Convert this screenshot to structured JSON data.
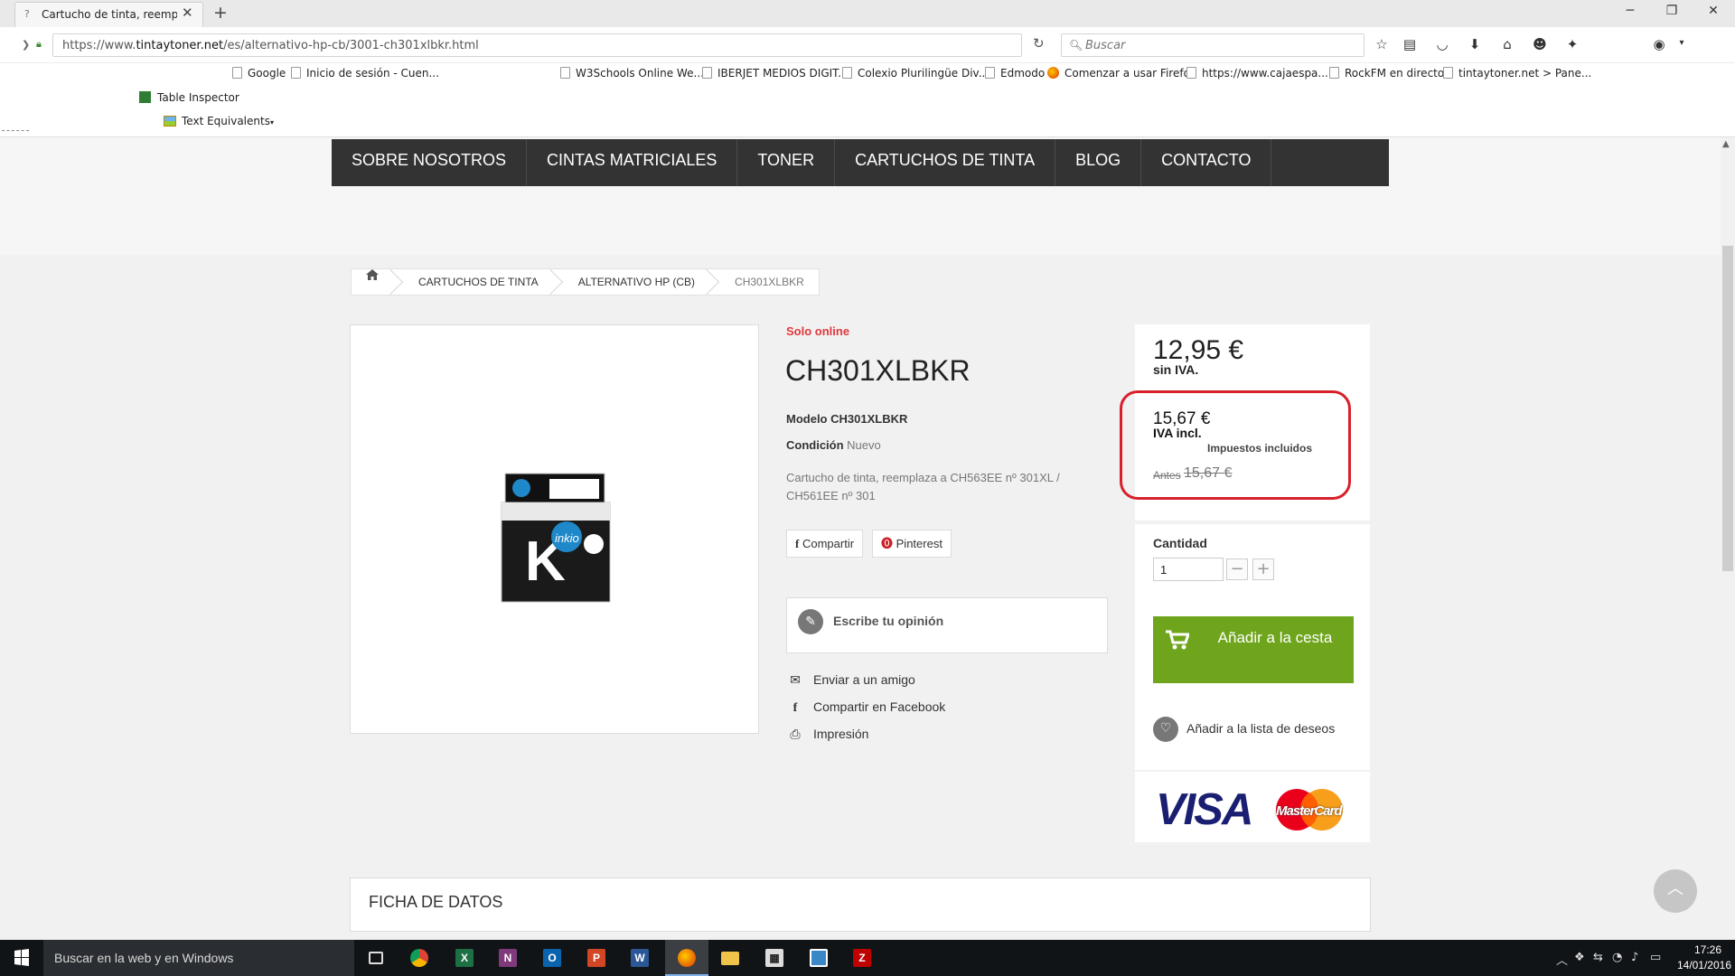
{
  "browser": {
    "tab_title": "Cartucho de tinta, reempl...",
    "tab_favicon": "?",
    "url_prefix": "https://www.",
    "url_domain": "tintaytoner.net",
    "url_path": "/es/alternativo-hp-cb/3001-ch301xlbkr.html",
    "search_placeholder": "Buscar",
    "toolbar_icons": [
      "star-icon",
      "reading-list-icon",
      "pocket-icon",
      "download-icon",
      "home-icon",
      "chat-icon",
      "sync-icon"
    ]
  },
  "bookmarks": [
    "Google",
    "Inicio de sesión - Cuen...",
    "W3Schools Online We...",
    "IBERJET MEDIOS DIGIT...",
    "Colexio Plurilingüe Div...",
    "Edmodo",
    "Comenzar a usar Firefox",
    "https://www.cajaespa...",
    "RockFM en directo",
    "tintaytoner.net > Pane..."
  ],
  "extensions": {
    "table_inspector": "Table Inspector",
    "text_equivalents": "Text Equivalents"
  },
  "menu": [
    "SOBRE NOSOTROS",
    "CINTAS MATRICIALES",
    "TONER",
    "CARTUCHOS DE TINTA",
    "BLOG",
    "CONTACTO"
  ],
  "breadcrumb": [
    "CARTUCHOS DE TINTA",
    "ALTERNATIVO HP (CB)",
    "CH301XLBKR"
  ],
  "product": {
    "badge": "Solo online",
    "title": "CH301XLBKR",
    "model_label": "Modelo",
    "model_value": "CH301XLBKR",
    "condition_label": "Condición",
    "condition_value": "Nuevo",
    "description": "Cartucho de tinta, reemplaza a CH563EE nº 301XL / CH561EE nº 301",
    "share_facebook": "Compartir",
    "share_pinterest": "Pinterest",
    "review": "Escribe tu opinión",
    "send_friend": "Enviar a un amigo",
    "share_fb_link": "Compartir en Facebook",
    "print": "Impresión",
    "image_brand": "inkio",
    "image_letter": "K"
  },
  "price": {
    "excl": "12,95 €",
    "excl_label": "sin IVA.",
    "incl": "15,67 €",
    "incl_label": "IVA incl.",
    "tax_note": "Impuestos incluidos",
    "old_label": "Antes",
    "old_price": "15,67 €"
  },
  "cart": {
    "qty_label": "Cantidad",
    "qty_value": "1",
    "add_to_cart": "Añadir a la cesta",
    "wishlist": "Añadir a la lista de deseos"
  },
  "payment": {
    "visa": "VISA",
    "mastercard": "MasterCard"
  },
  "datasheet_title": "FICHA DE DATOS",
  "taskbar": {
    "search": "Buscar en la web y en Windows",
    "time": "17:26",
    "date": "14/01/2016"
  },
  "colors": {
    "menu_bg": "#333333",
    "accent_red": "#e0383b",
    "highlight": "#d8202a",
    "cart_green": "#6fa51c"
  }
}
